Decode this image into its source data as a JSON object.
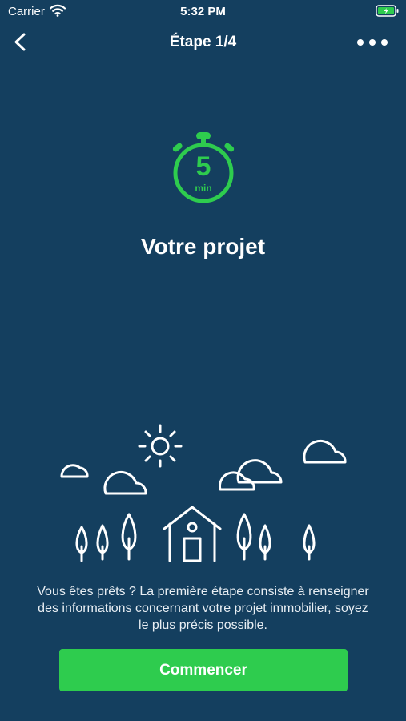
{
  "status_bar": {
    "carrier": "Carrier",
    "time": "5:32 PM"
  },
  "nav": {
    "title": "Étape 1/4"
  },
  "timer": {
    "value": "5",
    "unit": "min"
  },
  "main": {
    "title": "Votre projet",
    "description": "Vous êtes prêts ? La première étape consiste à renseigner des informations concernant votre projet immobilier, soyez le plus précis possible.",
    "start_label": "Commencer"
  },
  "colors": {
    "background": "#143f5f",
    "accent": "#2ecc4e",
    "foreground": "#ffffff"
  }
}
